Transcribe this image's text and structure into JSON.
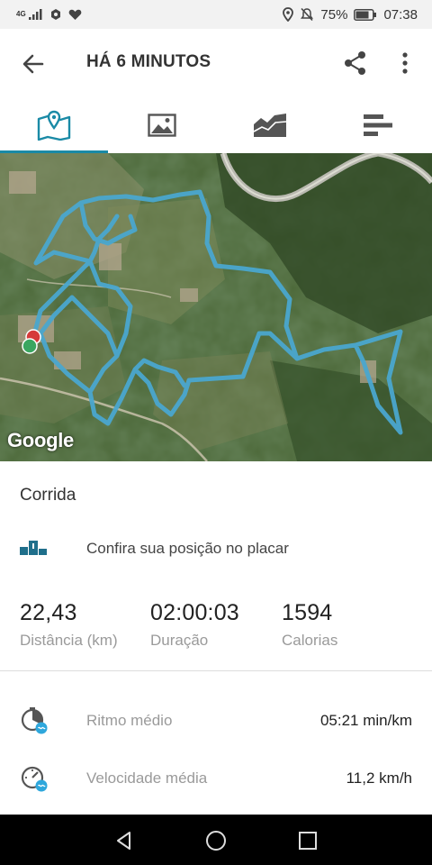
{
  "status_bar": {
    "network": "4G",
    "battery_percent": "75%",
    "time": "07:38",
    "icons": [
      "signal-icon",
      "shield-icon",
      "heart-icon",
      "location-icon",
      "mute-icon",
      "battery-icon"
    ]
  },
  "app_bar": {
    "title": "HÁ 6 MINUTOS",
    "icons": [
      "back-arrow-icon",
      "share-icon",
      "more-vertical-icon"
    ]
  },
  "tabs": [
    {
      "icon": "map-icon",
      "active": true
    },
    {
      "icon": "photo-icon",
      "active": false
    },
    {
      "icon": "chart-area-icon",
      "active": false
    },
    {
      "icon": "bars-icon",
      "active": false
    }
  ],
  "map": {
    "attribution": "Google",
    "route_color": "#4aa6cf",
    "start_marker_color": "#3aa660",
    "end_marker_color": "#d63a3a"
  },
  "activity": {
    "type": "Corrida",
    "leaderboard_text": "Confira sua posição no placar"
  },
  "stats": [
    {
      "value": "22,43",
      "label": "Distância (km)"
    },
    {
      "value": "02:00:03",
      "label": "Duração"
    },
    {
      "value": "1594",
      "label": "Calorias"
    }
  ],
  "metrics": [
    {
      "icon": "pace-icon",
      "label": "Ritmo médio",
      "value": "05:21 min/km"
    },
    {
      "icon": "speedometer-icon",
      "label": "Velocidade média",
      "value": "11,2 km/h"
    }
  ],
  "colors": {
    "accent": "#1a8aa6",
    "route": "#4aa6cf"
  }
}
